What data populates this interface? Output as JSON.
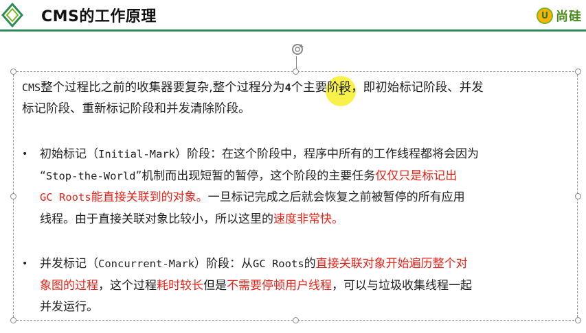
{
  "header": {
    "title": "CMS的工作原理",
    "brand_badge": "U",
    "brand_text": "尚硅"
  },
  "intro": {
    "p1": "CMS",
    "p2": "整个过程比之前的收集器要复杂,整个过程分为",
    "p3": "4",
    "p4": "个主要阶段，即初始标记阶段、并发",
    "p5": "标记阶段、重新标记阶段和并发清除阶段。"
  },
  "bullet1": {
    "dot": "•",
    "t1": "初始标记（",
    "t1m": "Initial-Mark",
    "t2": "）阶段：在这个阶段中，程序中所有的工作线程都将会因为",
    "t3": "“",
    "t3m": "Stop-the-World",
    "t4": "”机制而出现短暂的暂停，这个阶段的主要任务",
    "t4r": "仅仅只是标记出",
    "t5rm": "GC Roots",
    "t5r": "能直接关联到的对象。",
    "t6": "一旦标记完成之后就会恢复之前被暂停的所有应用",
    "t7": "线程。由于直接关联对象比较小，所以这里的",
    "t7r": "速度非常快。"
  },
  "bullet2": {
    "dot": "•",
    "t1": "并发标记（",
    "t1m": "Concurrent-Mark",
    "t2": "）阶段：从",
    "t2m": "GC Roots",
    "t3": "的",
    "t3r": "直接关联对象开始遍历整个对",
    "t4r": "象图的过程",
    "t5": "，这个过程",
    "t5r": "耗时较长",
    "t6": "但是",
    "t6r": "不需要停顿用户线程",
    "t7": "，可以与垃圾收集线程一起",
    "t8": "并发运行。"
  },
  "colors": {
    "accent_line": "#2e8b57",
    "highlight": "#f6ee2a",
    "emphasis_red": "#e8231a"
  }
}
